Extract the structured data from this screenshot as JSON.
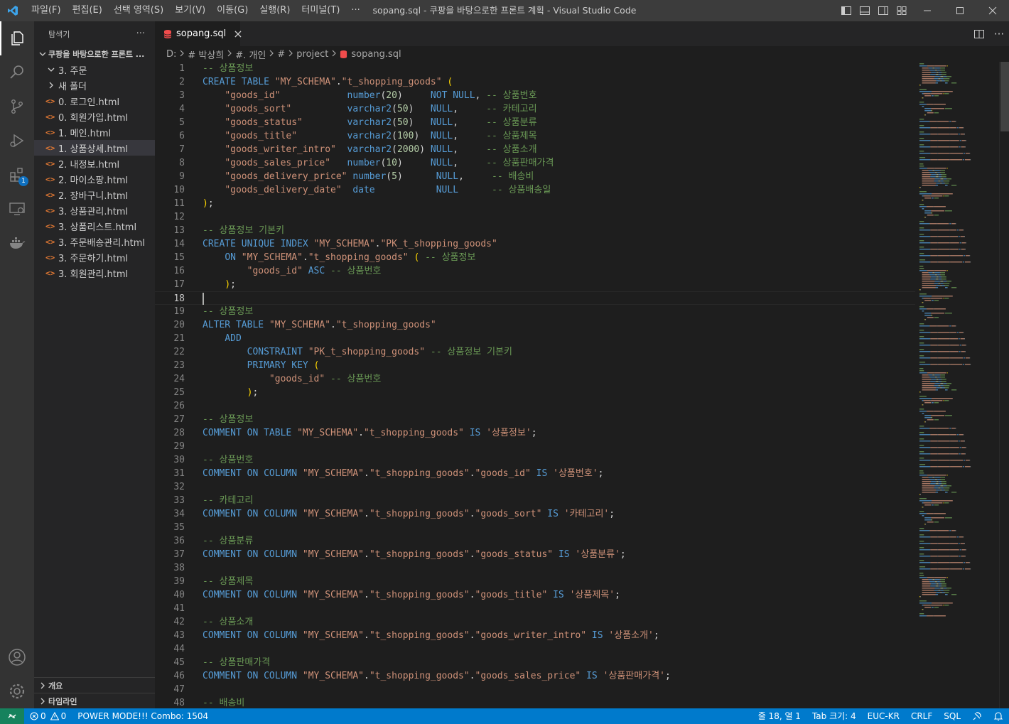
{
  "window": {
    "title": "sopang.sql - 쿠팡을 바탕으로한 프론트 계획 - Visual Studio Code",
    "menus": [
      "파일(F)",
      "편집(E)",
      "선택 영역(S)",
      "보기(V)",
      "이동(G)",
      "실행(R)",
      "터미널(T)",
      "···"
    ]
  },
  "activity_bar": [
    "explorer-icon",
    "search-icon",
    "source-control-icon",
    "run-debug-icon",
    "extensions-icon",
    "remote-explorer-icon",
    "docker-icon",
    "account-icon",
    "settings-gear-icon"
  ],
  "extensions_badge": "1",
  "sidebar": {
    "header": "탐색기",
    "more": "···",
    "folder": "쿠팡을 바탕으로한 프론트 ...",
    "items": [
      {
        "label": "3. 주문",
        "type": "folder-open"
      },
      {
        "label": "새 폴더",
        "type": "folder-closed"
      },
      {
        "label": "0. 로그인.html",
        "type": "html"
      },
      {
        "label": "0. 회원가입.html",
        "type": "html"
      },
      {
        "label": "1. 메인.html",
        "type": "html"
      },
      {
        "label": "1. 상품상세.html",
        "type": "html"
      },
      {
        "label": "2. 내정보.html",
        "type": "html"
      },
      {
        "label": "2. 마이소팡.html",
        "type": "html"
      },
      {
        "label": "2. 장바구니.html",
        "type": "html"
      },
      {
        "label": "3. 상품관리.html",
        "type": "html"
      },
      {
        "label": "3. 상품리스트.html",
        "type": "html"
      },
      {
        "label": "3. 주문배송관리.html",
        "type": "html"
      },
      {
        "label": "3. 주문하기.html",
        "type": "html"
      },
      {
        "label": "3. 회원관리.html",
        "type": "html"
      }
    ],
    "selected_index": 5,
    "outline": "개요",
    "timeline": "타임라인"
  },
  "tab": {
    "label": "sopang.sql",
    "close": "×"
  },
  "breadcrumb": [
    "D:",
    "# 박상희",
    "#. 개인",
    "#",
    "project",
    "sopang.sql"
  ],
  "current_line": 18,
  "code_lines": [
    [
      [
        "cm",
        "-- 상품정보"
      ]
    ],
    [
      [
        "kw",
        "CREATE TABLE "
      ],
      [
        "str",
        "\"MY_SCHEMA\""
      ],
      [
        "pn",
        "."
      ],
      [
        "str",
        "\"t_shopping_goods\""
      ],
      [
        "pn",
        " "
      ],
      [
        "br",
        "("
      ]
    ],
    [
      [
        "pn",
        "    "
      ],
      [
        "str",
        "\"goods_id\"            "
      ],
      [
        "kw",
        "number"
      ],
      [
        "pn",
        "("
      ],
      [
        "num",
        "20"
      ],
      [
        "pn",
        ")     "
      ],
      [
        "kw",
        "NOT NULL"
      ],
      [
        "pn",
        ", "
      ],
      [
        "cm",
        "-- 상품번호"
      ]
    ],
    [
      [
        "pn",
        "    "
      ],
      [
        "str",
        "\"goods_sort\"          "
      ],
      [
        "kw",
        "varchar2"
      ],
      [
        "pn",
        "("
      ],
      [
        "num",
        "50"
      ],
      [
        "pn",
        ")   "
      ],
      [
        "kw",
        "NULL"
      ],
      [
        "pn",
        ",     "
      ],
      [
        "cm",
        "-- 카테고리"
      ]
    ],
    [
      [
        "pn",
        "    "
      ],
      [
        "str",
        "\"goods_status\"        "
      ],
      [
        "kw",
        "varchar2"
      ],
      [
        "pn",
        "("
      ],
      [
        "num",
        "50"
      ],
      [
        "pn",
        ")   "
      ],
      [
        "kw",
        "NULL"
      ],
      [
        "pn",
        ",     "
      ],
      [
        "cm",
        "-- 상품분류"
      ]
    ],
    [
      [
        "pn",
        "    "
      ],
      [
        "str",
        "\"goods_title\"         "
      ],
      [
        "kw",
        "varchar2"
      ],
      [
        "pn",
        "("
      ],
      [
        "num",
        "100"
      ],
      [
        "pn",
        ")  "
      ],
      [
        "kw",
        "NULL"
      ],
      [
        "pn",
        ",     "
      ],
      [
        "cm",
        "-- 상품제목"
      ]
    ],
    [
      [
        "pn",
        "    "
      ],
      [
        "str",
        "\"goods_writer_intro\"  "
      ],
      [
        "kw",
        "varchar2"
      ],
      [
        "pn",
        "("
      ],
      [
        "num",
        "2000"
      ],
      [
        "pn",
        ") "
      ],
      [
        "kw",
        "NULL"
      ],
      [
        "pn",
        ",     "
      ],
      [
        "cm",
        "-- 상품소개"
      ]
    ],
    [
      [
        "pn",
        "    "
      ],
      [
        "str",
        "\"goods_sales_price\"   "
      ],
      [
        "kw",
        "number"
      ],
      [
        "pn",
        "("
      ],
      [
        "num",
        "10"
      ],
      [
        "pn",
        ")     "
      ],
      [
        "kw",
        "NULL"
      ],
      [
        "pn",
        ",     "
      ],
      [
        "cm",
        "-- 상품판매가격"
      ]
    ],
    [
      [
        "pn",
        "    "
      ],
      [
        "str",
        "\"goods_delivery_price\" "
      ],
      [
        "kw",
        "number"
      ],
      [
        "pn",
        "("
      ],
      [
        "num",
        "5"
      ],
      [
        "pn",
        ")      "
      ],
      [
        "kw",
        "NULL"
      ],
      [
        "pn",
        ",     "
      ],
      [
        "cm",
        "-- 배송비"
      ]
    ],
    [
      [
        "pn",
        "    "
      ],
      [
        "str",
        "\"goods_delivery_date\"  "
      ],
      [
        "kw",
        "date"
      ],
      [
        "pn",
        "           "
      ],
      [
        "kw",
        "NULL"
      ],
      [
        "pn",
        "      "
      ],
      [
        "cm",
        "-- 상품배송일"
      ]
    ],
    [
      [
        "br",
        ")"
      ],
      [
        "pn",
        ";"
      ]
    ],
    [],
    [
      [
        "cm",
        "-- 상품정보 기본키"
      ]
    ],
    [
      [
        "kw",
        "CREATE UNIQUE INDEX "
      ],
      [
        "str",
        "\"MY_SCHEMA\""
      ],
      [
        "pn",
        "."
      ],
      [
        "str",
        "\"PK_t_shopping_goods\""
      ]
    ],
    [
      [
        "pn",
        "    "
      ],
      [
        "kw",
        "ON "
      ],
      [
        "str",
        "\"MY_SCHEMA\""
      ],
      [
        "pn",
        "."
      ],
      [
        "str",
        "\"t_shopping_goods\""
      ],
      [
        "pn",
        " "
      ],
      [
        "br",
        "("
      ],
      [
        "pn",
        " "
      ],
      [
        "cm",
        "-- 상품정보"
      ]
    ],
    [
      [
        "pn",
        "        "
      ],
      [
        "str",
        "\"goods_id\""
      ],
      [
        "pn",
        " "
      ],
      [
        "kw",
        "ASC"
      ],
      [
        "pn",
        " "
      ],
      [
        "cm",
        "-- 상품번호"
      ]
    ],
    [
      [
        "pn",
        "    "
      ],
      [
        "br",
        ")"
      ],
      [
        "pn",
        ";"
      ]
    ],
    [],
    [
      [
        "cm",
        "-- 상품정보"
      ]
    ],
    [
      [
        "kw",
        "ALTER TABLE "
      ],
      [
        "str",
        "\"MY_SCHEMA\""
      ],
      [
        "pn",
        "."
      ],
      [
        "str",
        "\"t_shopping_goods\""
      ]
    ],
    [
      [
        "pn",
        "    "
      ],
      [
        "kw",
        "ADD"
      ]
    ],
    [
      [
        "pn",
        "        "
      ],
      [
        "kw",
        "CONSTRAINT "
      ],
      [
        "str",
        "\"PK_t_shopping_goods\""
      ],
      [
        "pn",
        " "
      ],
      [
        "cm",
        "-- 상품정보 기본키"
      ]
    ],
    [
      [
        "pn",
        "        "
      ],
      [
        "kw",
        "PRIMARY KEY "
      ],
      [
        "br",
        "("
      ]
    ],
    [
      [
        "pn",
        "            "
      ],
      [
        "str",
        "\"goods_id\""
      ],
      [
        "pn",
        " "
      ],
      [
        "cm",
        "-- 상품번호"
      ]
    ],
    [
      [
        "pn",
        "        "
      ],
      [
        "br",
        ")"
      ],
      [
        "pn",
        ";"
      ]
    ],
    [],
    [
      [
        "cm",
        "-- 상품정보"
      ]
    ],
    [
      [
        "kw",
        "COMMENT ON TABLE "
      ],
      [
        "str",
        "\"MY_SCHEMA\""
      ],
      [
        "pn",
        "."
      ],
      [
        "str",
        "\"t_shopping_goods\""
      ],
      [
        "pn",
        " "
      ],
      [
        "kw",
        "IS"
      ],
      [
        "pn",
        " "
      ],
      [
        "str",
        "'상품정보'"
      ],
      [
        "pn",
        ";"
      ]
    ],
    [],
    [
      [
        "cm",
        "-- 상품번호"
      ]
    ],
    [
      [
        "kw",
        "COMMENT ON COLUMN "
      ],
      [
        "str",
        "\"MY_SCHEMA\""
      ],
      [
        "pn",
        "."
      ],
      [
        "str",
        "\"t_shopping_goods\""
      ],
      [
        "pn",
        "."
      ],
      [
        "str",
        "\"goods_id\""
      ],
      [
        "pn",
        " "
      ],
      [
        "kw",
        "IS"
      ],
      [
        "pn",
        " "
      ],
      [
        "str",
        "'상품번호'"
      ],
      [
        "pn",
        ";"
      ]
    ],
    [],
    [
      [
        "cm",
        "-- 카테고리"
      ]
    ],
    [
      [
        "kw",
        "COMMENT ON COLUMN "
      ],
      [
        "str",
        "\"MY_SCHEMA\""
      ],
      [
        "pn",
        "."
      ],
      [
        "str",
        "\"t_shopping_goods\""
      ],
      [
        "pn",
        "."
      ],
      [
        "str",
        "\"goods_sort\""
      ],
      [
        "pn",
        " "
      ],
      [
        "kw",
        "IS"
      ],
      [
        "pn",
        " "
      ],
      [
        "str",
        "'카테고리'"
      ],
      [
        "pn",
        ";"
      ]
    ],
    [],
    [
      [
        "cm",
        "-- 상품분류"
      ]
    ],
    [
      [
        "kw",
        "COMMENT ON COLUMN "
      ],
      [
        "str",
        "\"MY_SCHEMA\""
      ],
      [
        "pn",
        "."
      ],
      [
        "str",
        "\"t_shopping_goods\""
      ],
      [
        "pn",
        "."
      ],
      [
        "str",
        "\"goods_status\""
      ],
      [
        "pn",
        " "
      ],
      [
        "kw",
        "IS"
      ],
      [
        "pn",
        " "
      ],
      [
        "str",
        "'상품분류'"
      ],
      [
        "pn",
        ";"
      ]
    ],
    [],
    [
      [
        "cm",
        "-- 상품제목"
      ]
    ],
    [
      [
        "kw",
        "COMMENT ON COLUMN "
      ],
      [
        "str",
        "\"MY_SCHEMA\""
      ],
      [
        "pn",
        "."
      ],
      [
        "str",
        "\"t_shopping_goods\""
      ],
      [
        "pn",
        "."
      ],
      [
        "str",
        "\"goods_title\""
      ],
      [
        "pn",
        " "
      ],
      [
        "kw",
        "IS"
      ],
      [
        "pn",
        " "
      ],
      [
        "str",
        "'상품제목'"
      ],
      [
        "pn",
        ";"
      ]
    ],
    [],
    [
      [
        "cm",
        "-- 상품소개"
      ]
    ],
    [
      [
        "kw",
        "COMMENT ON COLUMN "
      ],
      [
        "str",
        "\"MY_SCHEMA\""
      ],
      [
        "pn",
        "."
      ],
      [
        "str",
        "\"t_shopping_goods\""
      ],
      [
        "pn",
        "."
      ],
      [
        "str",
        "\"goods_writer_intro\""
      ],
      [
        "pn",
        " "
      ],
      [
        "kw",
        "IS"
      ],
      [
        "pn",
        " "
      ],
      [
        "str",
        "'상품소개'"
      ],
      [
        "pn",
        ";"
      ]
    ],
    [],
    [
      [
        "cm",
        "-- 상품판매가격"
      ]
    ],
    [
      [
        "kw",
        "COMMENT ON COLUMN "
      ],
      [
        "str",
        "\"MY_SCHEMA\""
      ],
      [
        "pn",
        "."
      ],
      [
        "str",
        "\"t_shopping_goods\""
      ],
      [
        "pn",
        "."
      ],
      [
        "str",
        "\"goods_sales_price\""
      ],
      [
        "pn",
        " "
      ],
      [
        "kw",
        "IS"
      ],
      [
        "pn",
        " "
      ],
      [
        "str",
        "'상품판매가격'"
      ],
      [
        "pn",
        ";"
      ]
    ],
    [],
    [
      [
        "cm",
        "-- 배송비"
      ]
    ]
  ],
  "statusbar": {
    "errors": "0",
    "warnings": "0",
    "power_mode": "POWER MODE!!! Combo: 1504",
    "cursor": "줄 18, 열 1",
    "tab_size": "Tab 크기: 4",
    "encoding": "EUC-KR",
    "eol": "CRLF",
    "language": "SQL"
  },
  "colors": {
    "accent": "#007acc",
    "keyword": "#569cd6",
    "string": "#ce9178",
    "number": "#b5cea8",
    "comment": "#6a9955",
    "bracket": "#ffd700"
  }
}
